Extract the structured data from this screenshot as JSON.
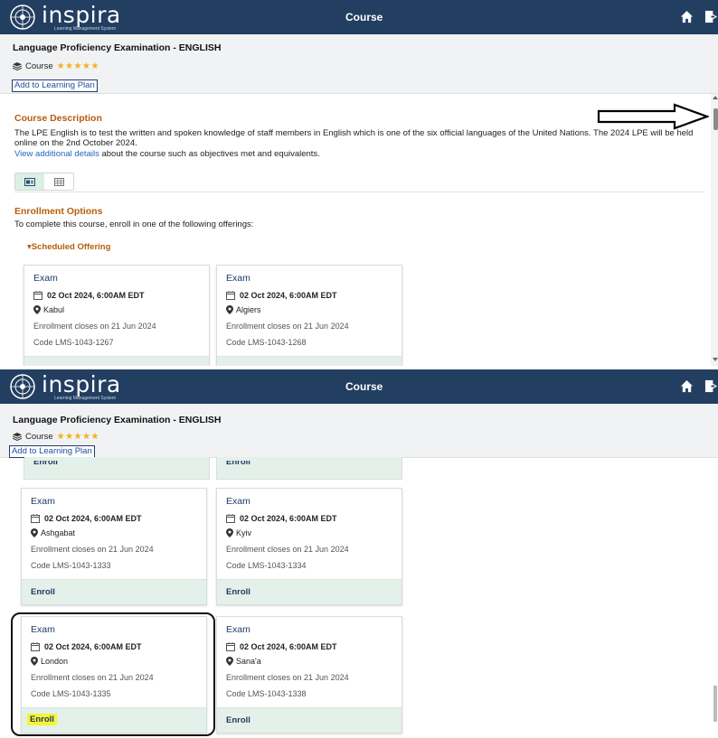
{
  "app": {
    "brand_name": "inspira",
    "brand_subtitle": "Learning Management System",
    "header_title": "Course",
    "icons": [
      "un-logo-icon",
      "home-icon",
      "sign-out-icon"
    ]
  },
  "course": {
    "title": "Language Proficiency Examination - ENGLISH",
    "type_label": "Course",
    "rating_stars": "★★★★★",
    "add_to_plan_label": "Add to Learning Plan"
  },
  "description": {
    "heading": "Course Description",
    "text": "The LPE English is to test the written and spoken knowledge of staff members in English which is one of the six official languages of the United Nations. The 2024 LPE will be held online on the 2nd October 2024.",
    "link_label": "View additional details",
    "link_suffix": " about the course such as objectives met and equivalents."
  },
  "enrollment": {
    "heading": "Enrollment Options",
    "intro": "To complete this course, enroll in one of the following offerings:",
    "offering_label": "Scheduled Offering",
    "partial_enroll_label": "Enroll"
  },
  "offerings_top": [
    {
      "title": "Exam",
      "date": "02 Oct 2024, 6:00AM EDT",
      "location": "Kabul",
      "closes": "Enrollment closes on 21 Jun 2024",
      "code": "Code  LMS-1043-1267"
    },
    {
      "title": "Exam",
      "date": "02 Oct 2024, 6:00AM EDT",
      "location": "Algiers",
      "closes": "Enrollment closes on 21 Jun 2024",
      "code": "Code  LMS-1043-1268"
    }
  ],
  "offerings_bottom": [
    {
      "title": "Exam",
      "date": "02 Oct 2024, 6:00AM EDT",
      "location": "Ashgabat",
      "closes": "Enrollment closes on 21 Jun 2024",
      "code": "Code  LMS-1043-1333",
      "enroll_label": "Enroll"
    },
    {
      "title": "Exam",
      "date": "02 Oct 2024, 6:00AM EDT",
      "location": "Kyiv",
      "closes": "Enrollment closes on 21 Jun 2024",
      "code": "Code  LMS-1043-1334",
      "enroll_label": "Enroll"
    },
    {
      "title": "Exam",
      "date": "02 Oct 2024, 6:00AM EDT",
      "location": "London",
      "closes": "Enrollment closes on 21 Jun 2024",
      "code": "Code  LMS-1043-1335",
      "enroll_label": "Enroll"
    },
    {
      "title": "Exam",
      "date": "02 Oct 2024, 6:00AM EDT",
      "location": "Sana'a",
      "closes": "Enrollment closes on 21 Jun 2024",
      "code": "Code  LMS-1043-1338",
      "enroll_label": "Enroll"
    }
  ],
  "annotation": {
    "highlight_color": "#f5f536",
    "frame_color": "#111111"
  },
  "colors": {
    "header_bg": "#223e61",
    "section_heading": "#b55d0e",
    "link": "#2467c4",
    "card_footer": "#e3f1ea"
  }
}
